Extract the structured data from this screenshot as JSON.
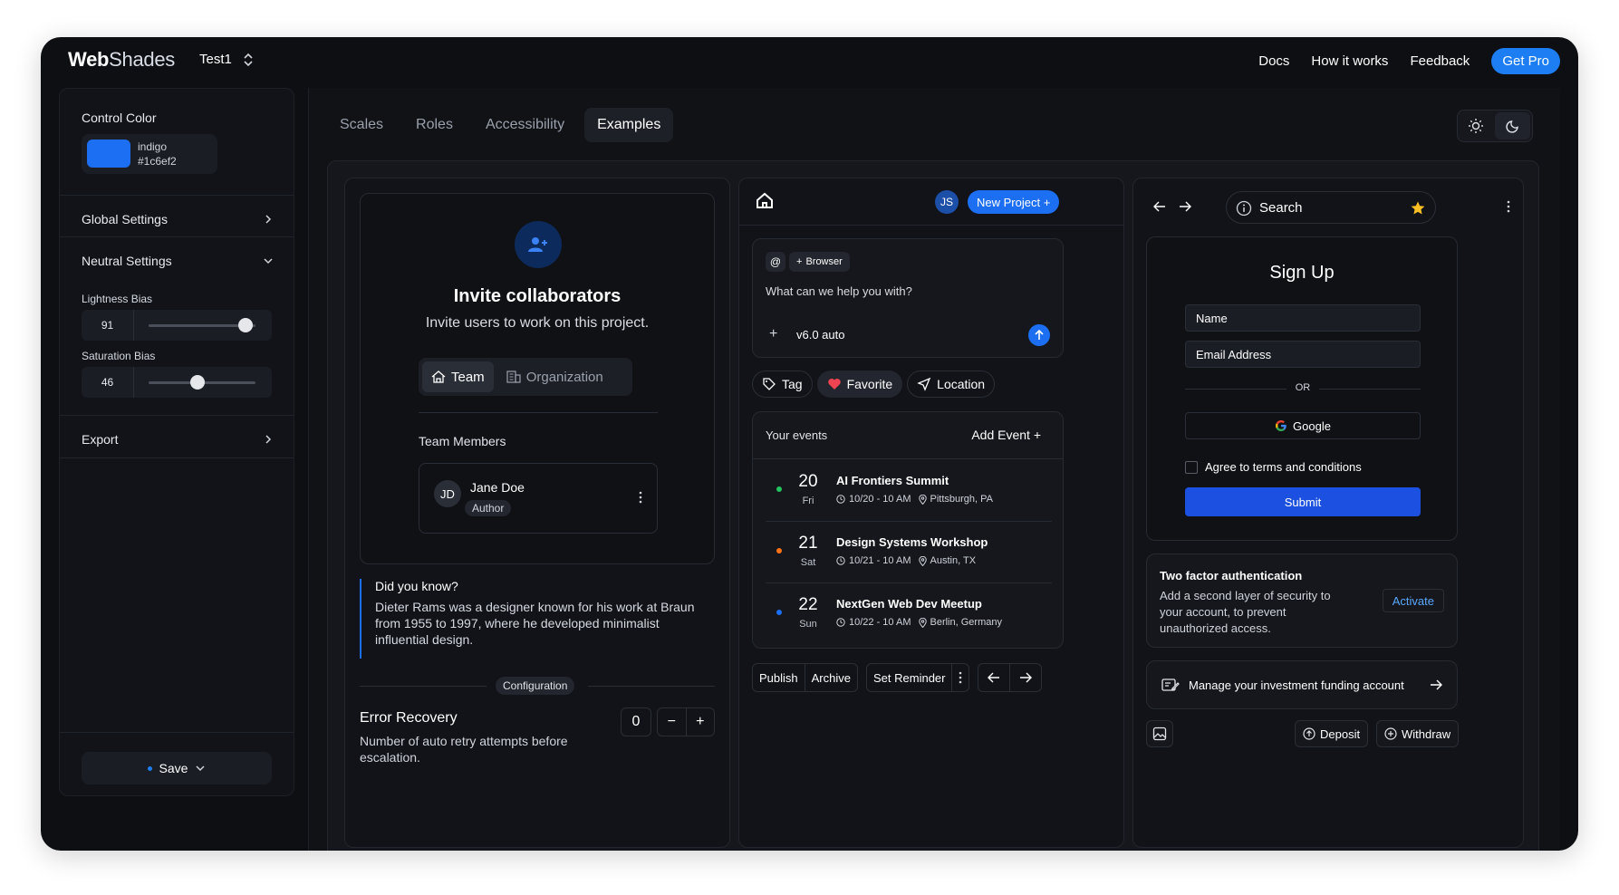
{
  "colors": {
    "accent": "#1c6ef2",
    "get_pro": "#1c7ef2",
    "submit": "#1c50e0",
    "activate": "#5aa7ff",
    "heart": "#f04452"
  },
  "header": {
    "brand_bold": "Web",
    "brand_light": "Shades",
    "project": "Test1",
    "nav": [
      "Docs",
      "How it works",
      "Feedback"
    ],
    "get_pro": "Get Pro"
  },
  "sidebar": {
    "control_color_label": "Control Color",
    "control_color_name": "indigo",
    "control_color_hex": "#1c6ef2",
    "global_settings": "Global Settings",
    "neutral_settings": "Neutral Settings",
    "lightness_bias_label": "Lightness Bias",
    "lightness_bias_value": "91",
    "lightness_bias_fraction": 0.91,
    "saturation_bias_label": "Saturation Bias",
    "saturation_bias_value": "46",
    "saturation_bias_fraction": 0.46,
    "export": "Export",
    "save": "Save"
  },
  "tabs": [
    "Scales",
    "Roles",
    "Accessibility",
    "Examples"
  ],
  "active_tab": "Examples",
  "invite": {
    "title": "Invite collaborators",
    "subtitle": "Invite users to work on this project.",
    "seg_team": "Team",
    "seg_org": "Organization",
    "members_label": "Team Members",
    "member_initials": "JD",
    "member_name": "Jane Doe",
    "member_role": "Author"
  },
  "tip": {
    "title": "Did you know?",
    "text": "Dieter Rams was a designer known for his work at Braun from 1955 to 1997, where he developed minimalist influential design."
  },
  "config": {
    "badge": "Configuration",
    "title": "Error Recovery",
    "subtitle": "Number of auto retry attempts before escalation.",
    "value": "0",
    "minus": "−",
    "plus": "+"
  },
  "project": {
    "initials": "JS",
    "new_project": "New Project +"
  },
  "prompt": {
    "at": "@",
    "browser_chip": "Browser",
    "question": "What can we help you with?",
    "plus": "+",
    "model": "v6.0 auto"
  },
  "chips": {
    "tag": "Tag",
    "favorite": "Favorite",
    "location": "Location"
  },
  "events": {
    "title": "Your events",
    "add": "Add Event +",
    "items": [
      {
        "day": "20",
        "weekday": "Fri",
        "name": "AI Frontiers Summit",
        "time": "10/20 - 10 AM",
        "place": "Pittsburgh, PA",
        "dot": "#22c55e"
      },
      {
        "day": "21",
        "weekday": "Sat",
        "name": "Design Systems Workshop",
        "time": "10/21 - 10 AM",
        "place": "Austin, TX",
        "dot": "#f97316"
      },
      {
        "day": "22",
        "weekday": "Sun",
        "name": "NextGen Web Dev Meetup",
        "time": "10/22 - 10 AM",
        "place": "Berlin, Germany",
        "dot": "#1c6ef2"
      }
    ]
  },
  "actions": {
    "publish": "Publish",
    "archive": "Archive",
    "reminder": "Set Reminder"
  },
  "browser": {
    "search": "Search"
  },
  "signup": {
    "title": "Sign Up",
    "name_placeholder": "Name",
    "email_placeholder": "Email Address",
    "or": "OR",
    "google": "Google",
    "terms": "Agree to terms and conditions",
    "submit": "Submit"
  },
  "tfa": {
    "title": "Two factor authentication",
    "text": "Add a second layer of security to your account, to prevent unauthorized access.",
    "button": "Activate"
  },
  "invest": {
    "label": "Manage your investment funding account"
  },
  "funds": {
    "deposit": "Deposit",
    "withdraw": "Withdraw"
  }
}
